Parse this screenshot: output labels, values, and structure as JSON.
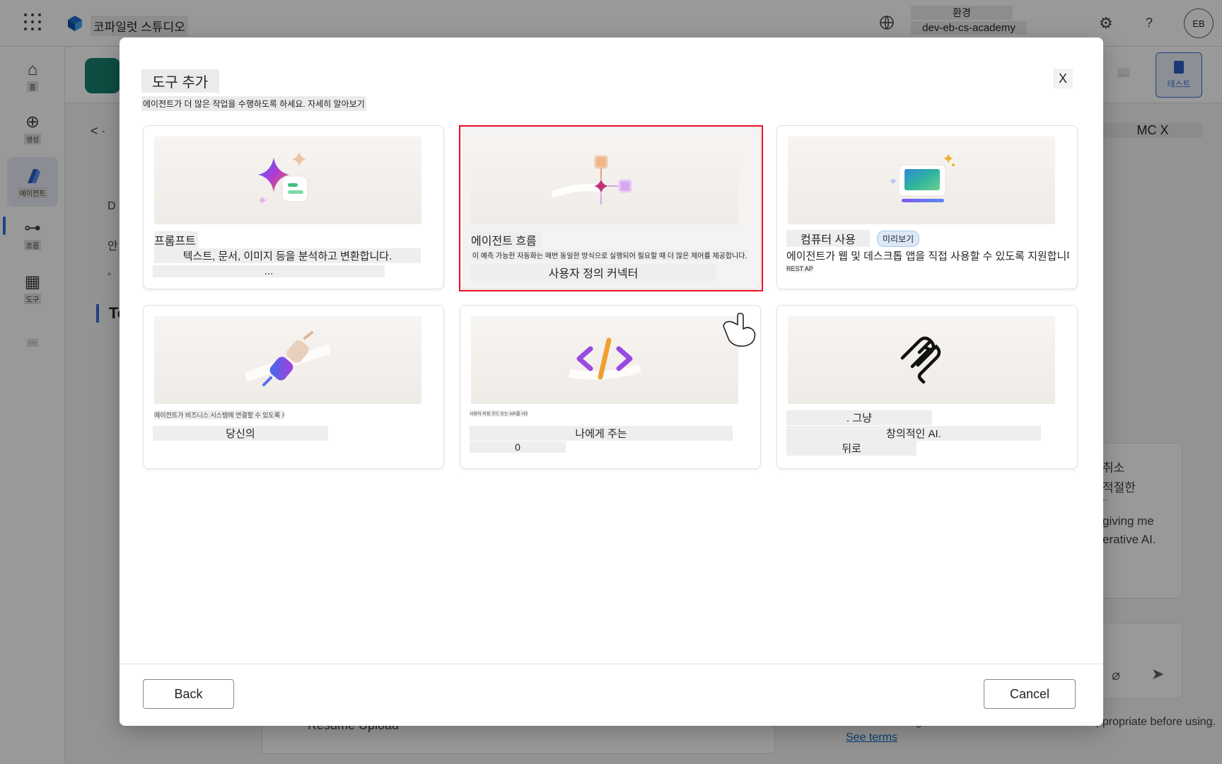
{
  "app": {
    "title": "코파일럿 스튜디오",
    "env_label": "환경",
    "env_value": "dev-eb-cs-academy",
    "avatar": "EB",
    "help_glyph": "?"
  },
  "nav": {
    "home": "홈",
    "create": "생성",
    "agents": "에이전트",
    "flows": "흐름",
    "tools": "도구"
  },
  "background": {
    "back": "< ·",
    "side1": "D",
    "side2": "안",
    "side3": "^",
    "heading": "To",
    "mc": "MC X",
    "dots": "...",
    "test_label": "테스트",
    "card_item": "Resume Upload",
    "chat_lines": [
      "취소",
      "적절한",
      "...",
      "giving me",
      "erative AI."
    ],
    "footer_text": "Make sure AI-generated content is accurate and appropriate before using.",
    "footer_link": "See terms"
  },
  "modal": {
    "title": "도구 추가",
    "subtitle": "에이전트가 더 많은 작업을 수행하도록 하세요. 자세히 알아보기",
    "close": "X",
    "back_label": "Back",
    "cancel_label": "Cancel"
  },
  "cards": {
    "prompt": {
      "title": "프롬프트",
      "desc": "텍스트, 문서, 이미지 등을 분석하고 변환합니다.",
      "more": "..."
    },
    "agent_flow": {
      "title": "에이전트 흐름",
      "desc": "이 예측 가능한 자동화는 매번 동일한 방식으로 실행되어 필요할 때 더 많은 제어를 제공합니다.",
      "extra": "사용자 정의 커넥터"
    },
    "computer_use": {
      "title": "컴퓨터 사용",
      "badge": "미리보기",
      "desc": "에이전트가 웹 및 데스크톱 앱을 직접 사용할 수 있도록 지원합니다.",
      "extra": "REST API"
    },
    "connector": {
      "tiny": "에이전트가 비즈니스 시스템에 연결할 수 있도록 커넥터를 사용합니다",
      "desc": "당신의"
    },
    "custom": {
      "tiny": "사용자 지정 코드 또는 API를 사용합니다",
      "desc": "나에게 주는",
      "value": "0"
    },
    "mcp": {
      "title": ". 그냥",
      "desc": "창의적인 AI.",
      "extra": "뒤로"
    }
  },
  "colors": {
    "highlight": "#e81123",
    "accent": "#3a6fd8",
    "agent_tile": "#16806f"
  }
}
